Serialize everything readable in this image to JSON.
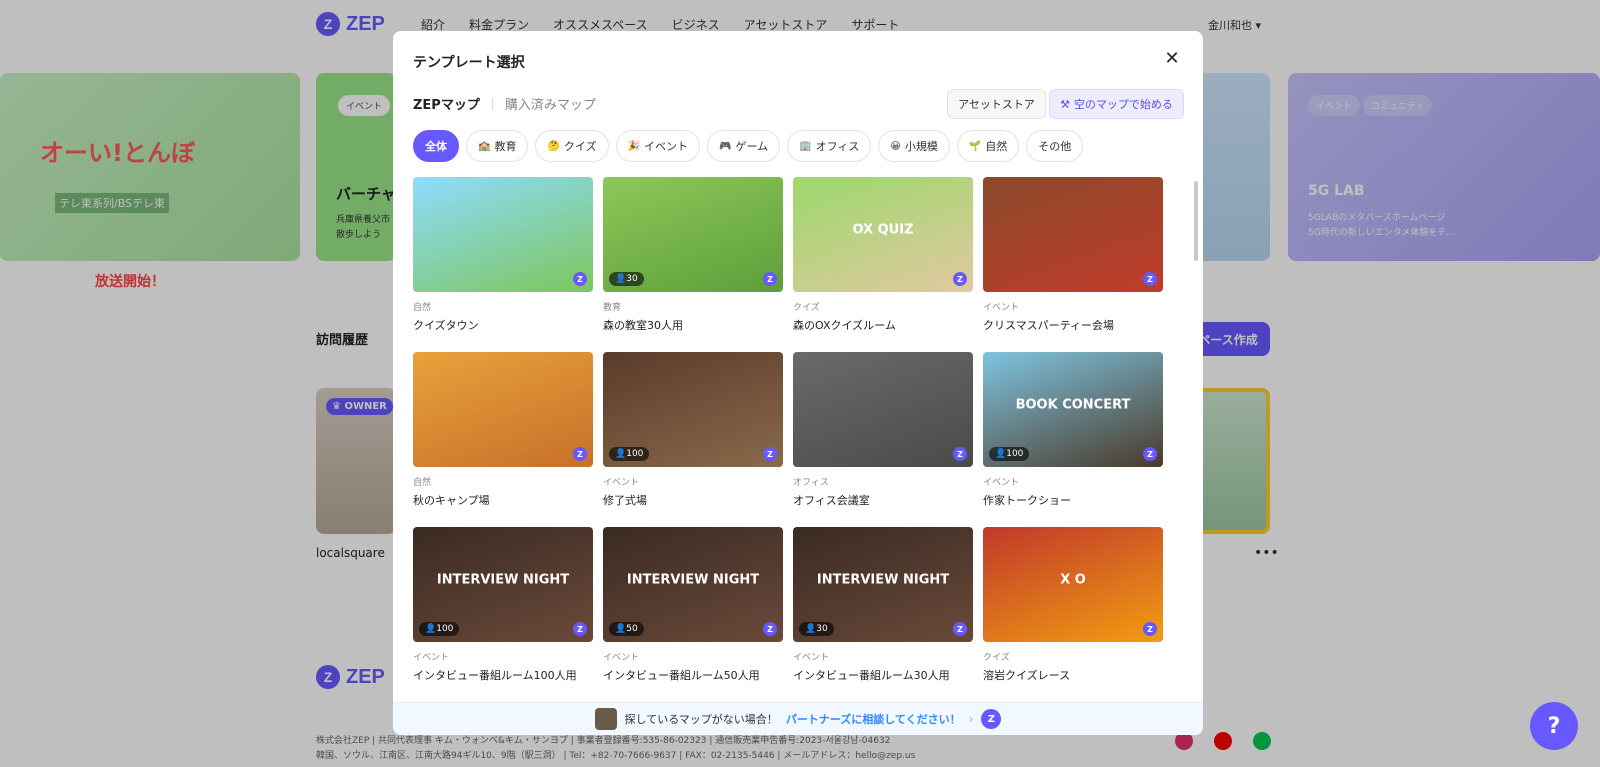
{
  "topnav": {
    "logo": "ZEP",
    "links": [
      "紹介",
      "料金プラン",
      "オススメスペース",
      "ビジネス",
      "アセットストア",
      "サポート"
    ],
    "user": "金川和也"
  },
  "banners": {
    "b1_title": "オーい!とんぼ",
    "b1_sub": "テレ東系列/BSテレ東",
    "b1_cta": "放送開始！",
    "b2_tag": "イベント",
    "b2_title": "バーチャ",
    "b2_sub1": "兵庫県養父市",
    "b2_sub2": "散歩しよう",
    "b4_tag1": "イベント",
    "b4_tag2": "コミュニティ",
    "b4_title": "5G LAB",
    "b4_sub1": "5GLABのメタバースホームページ",
    "b4_sub2": "5G時代の新しいエンタメ体験をチ..."
  },
  "page": {
    "visit_label": "訪問履歴",
    "create_label": "ペース作成",
    "owner_badge": "OWNER",
    "space_name": "localsquare",
    "more": "•••"
  },
  "footer": {
    "logo": "ZEP",
    "line1": "株式会社ZEP | 共同代表理事 キム・ウォンベ&キム・サンヨプ | 事業者登録番号:535-86-02323 | 通信販売業申告番号:2023-서울강남-04632",
    "line2": "韓国、ソウル、江南区、江南大路94ギル10、9階（駅三洞） | Tel：+82-70-7666-9637 | FAX：02-2135-5446 | メールアドレス：hello@zep.us"
  },
  "help_fab": "?",
  "modal": {
    "title": "テンプレート選択",
    "close": "✕",
    "tab_active": "ZEPマップ",
    "tab_other": "購入済みマップ",
    "asset_store": "アセットストア",
    "blank_map": "空のマップで始める",
    "filters": [
      {
        "label": "全体",
        "icon": ""
      },
      {
        "label": "教育",
        "icon": "🏫"
      },
      {
        "label": "クイズ",
        "icon": "🤔"
      },
      {
        "label": "イベント",
        "icon": "🎉"
      },
      {
        "label": "ゲーム",
        "icon": "🎮"
      },
      {
        "label": "オフィス",
        "icon": "🏢"
      },
      {
        "label": "小規模",
        "icon": "😀"
      },
      {
        "label": "自然",
        "icon": "🌱"
      },
      {
        "label": "その他",
        "icon": ""
      }
    ],
    "cards": [
      {
        "cat": "自然",
        "name": "クイズタウン",
        "cap": "",
        "deco": "",
        "c1": "#8fdcff",
        "c2": "#7cc65c"
      },
      {
        "cat": "教育",
        "name": "森の教室30人用",
        "cap": "30",
        "deco": "",
        "c1": "#8cc95a",
        "c2": "#5e9e3a"
      },
      {
        "cat": "クイズ",
        "name": "森のOXクイズルーム",
        "cap": "",
        "deco": "OX QUIZ",
        "c1": "#9bd86b",
        "c2": "#e2c9a0"
      },
      {
        "cat": "イベント",
        "name": "クリスマスパーティー会場",
        "cap": "",
        "deco": "",
        "c1": "#8a4a2a",
        "c2": "#c23b2a"
      },
      {
        "cat": "自然",
        "name": "秋のキャンプ場",
        "cap": "",
        "deco": "",
        "c1": "#e7a23a",
        "c2": "#c8702a"
      },
      {
        "cat": "イベント",
        "name": "修了式場",
        "cap": "100",
        "deco": "",
        "c1": "#5a3a2a",
        "c2": "#8a6a4a"
      },
      {
        "cat": "オフィス",
        "name": "オフィス会議室",
        "cap": "",
        "deco": "",
        "c1": "#6a6a6a",
        "c2": "#4a4a4a"
      },
      {
        "cat": "イベント",
        "name": "作家トークショー",
        "cap": "100",
        "deco": "BOOK CONCERT",
        "c1": "#7fc4e0",
        "c2": "#4a3a2a"
      },
      {
        "cat": "イベント",
        "name": "インタビュー番組ルーム100人用",
        "cap": "100",
        "deco": "INTERVIEW NIGHT",
        "c1": "#3a2a22",
        "c2": "#6a4a3a"
      },
      {
        "cat": "イベント",
        "name": "インタビュー番組ルーム50人用",
        "cap": "50",
        "deco": "INTERVIEW NIGHT",
        "c1": "#3a2a22",
        "c2": "#6a4a3a"
      },
      {
        "cat": "イベント",
        "name": "インタビュー番組ルーム30人用",
        "cap": "30",
        "deco": "INTERVIEW NIGHT",
        "c1": "#3a2a22",
        "c2": "#6a4a3a"
      },
      {
        "cat": "クイズ",
        "name": "溶岩クイズレース",
        "cap": "",
        "deco": "X O",
        "c1": "#c0392b",
        "c2": "#f39c12"
      }
    ],
    "footer_text": "探しているマップがない場合！",
    "footer_link": "パートナーズに相談してください！",
    "footer_arrow": "›",
    "footer_logo": "Z"
  }
}
